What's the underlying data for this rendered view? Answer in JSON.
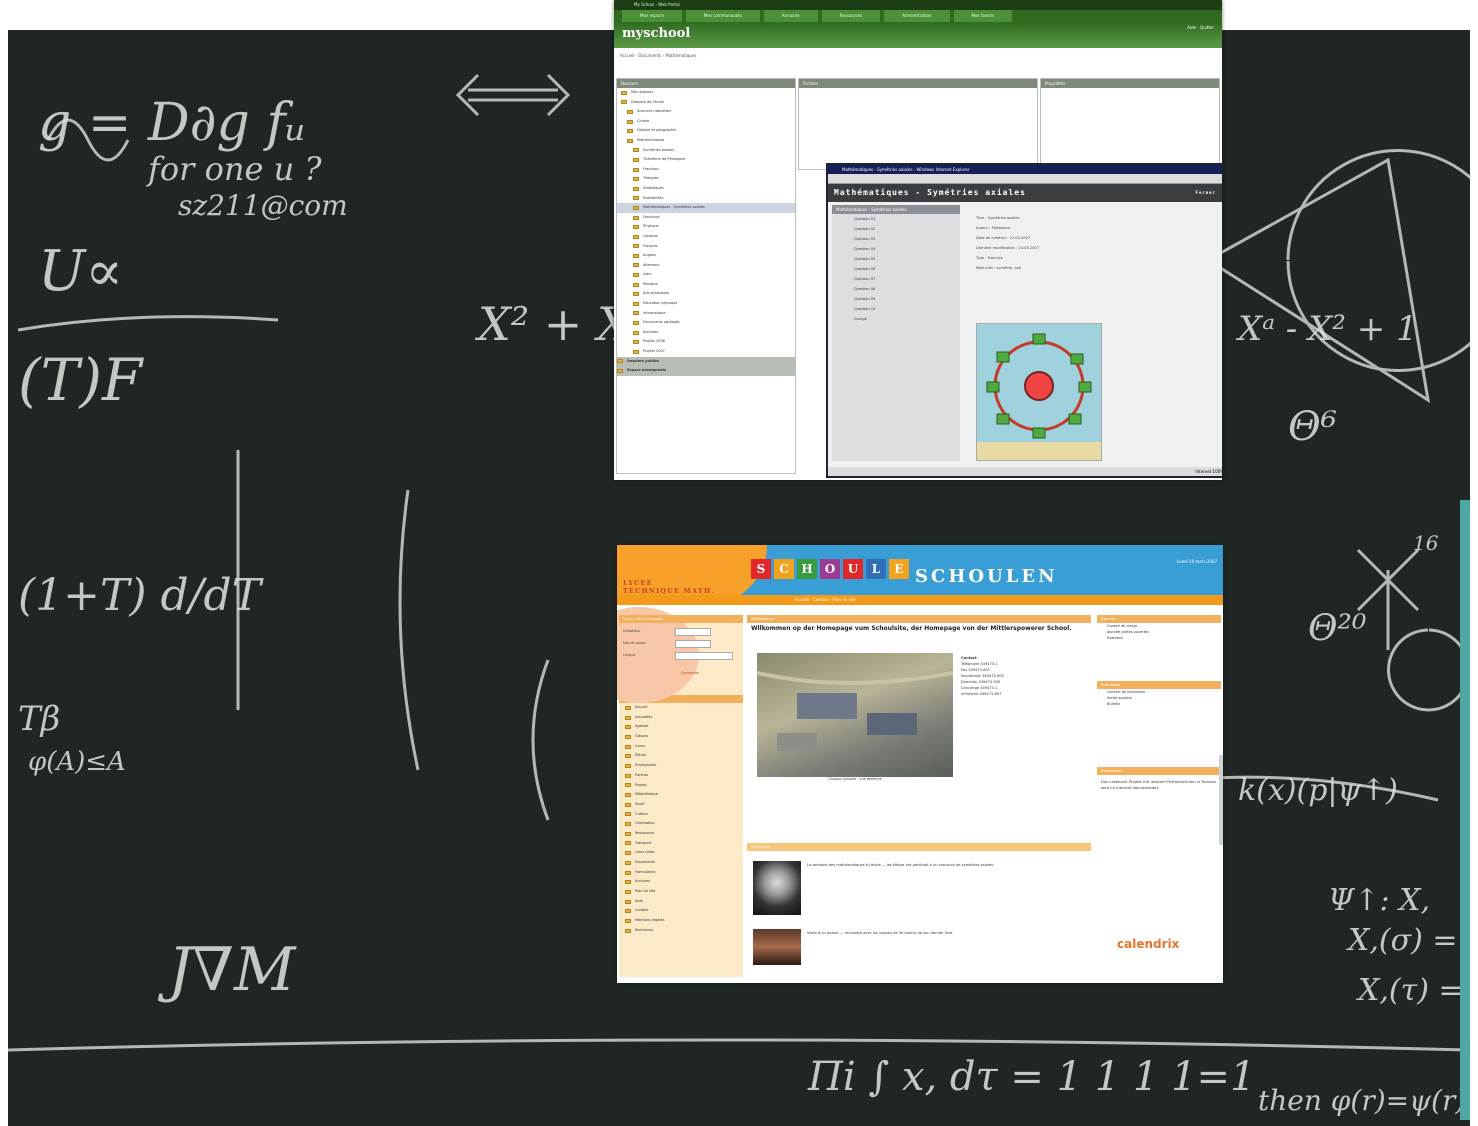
{
  "chalkboard": {
    "accent_color": "#4fa6a2",
    "background_color": "#1f2623",
    "formulas": [
      "g = D∂g fᵤ",
      "for one u ?",
      "sz211@com",
      "U∝",
      "(T)F",
      "(1+T) d/dT",
      "Tβ",
      "φ(A)≤A",
      "J∇M",
      "Πi ∫ x, dτ = 1 1 1 1=1",
      "16",
      "X² + X",
      "Xᵃ - X² + 1",
      "Θ⁶",
      "Θ²⁰",
      "k(x)(p|ψ↑)",
      "Ψ↑: X,",
      "X,(σ) =",
      "X,(τ) =",
      "then φ(r)=ψ(r)"
    ]
  },
  "top_window": {
    "topbar_text": "My School · Web Portal",
    "tabs": [
      "Mon espace",
      "Mes communautés",
      "Annuaire",
      "Ressources",
      "Administration",
      "Mes favoris"
    ],
    "logo": "myschool",
    "user_links": "Aide · Quitter",
    "breadcrumb": "Accueil › Documents › Mathématiques",
    "left_pane_title": "Dossiers",
    "tree_items": [
      "Mes dossiers",
      "Dossiers de l'école",
      "Sciences naturelles",
      "Chimie",
      "Histoire et géographie",
      "Mathématiques",
      "Symétries axiales",
      "Théorème de Pythagore",
      "Fractions",
      "Triangles",
      "Statistiques",
      "Probabilités",
      "Mathématiques - Symétries axiales",
      "Fonctions",
      "Physique",
      "Langues",
      "Français",
      "Anglais",
      "Allemand",
      "Latin",
      "Musique",
      "Arts plastiques",
      "Éducation physique",
      "Informatique",
      "Documents partagés",
      "Archives",
      "Projets 2006",
      "Projets 2007"
    ],
    "tree_groups": [
      "Dossiers publics",
      "Espace enseignants"
    ],
    "middle_pane_title": "Fichiers",
    "right_pane_title": "Propriétés",
    "popup_title": "Mathématiques - Symétries axiales - Windows Internet Explorer",
    "popup_heading": "Mathématiques - Symétries axiales",
    "popup_close": "Fermer",
    "popup_list_header": "Mathématiques - Symétries axiales",
    "popup_items": [
      "Question 01",
      "Question 02",
      "Question 03",
      "Question 04",
      "Question 05",
      "Question 06",
      "Question 07",
      "Question 08",
      "Question 09",
      "Question 10",
      "Corrigé"
    ],
    "popup_fields": [
      "Titre : Symétries axiales",
      "Auteur : Professeur",
      "Date de création : 12.03.2007",
      "Dernière modification : 14.03.2007",
      "Type : Exercice",
      "Mots-clés : symétrie, axe"
    ],
    "popup_footer": "Internet   100%"
  },
  "bottom_window": {
    "banner_letters": [
      "S",
      "C",
      "H",
      "O",
      "U",
      "L",
      "E"
    ],
    "banner_word": "SCHOULEN",
    "school_name_line1": "LYCEE",
    "school_name_line2": "TECHNIQUE MATH.",
    "nav_links": "Accueil · Contact · Plan du site",
    "date": "Lundi 19 mars 2007",
    "login_title": "Login / Mot de passe",
    "login_user": "Utilisateur",
    "login_pass": "Mot de passe",
    "login_lang": "Langue",
    "login_button": "Connexion",
    "nav_title": "Navigation",
    "nav_items": [
      "Accueil",
      "Actualités",
      "Agenda",
      "Classes",
      "Cours",
      "Élèves",
      "Enseignants",
      "Parents",
      "Projets",
      "Médiathèque",
      "Sport",
      "Culture",
      "Orientation",
      "Restaurant",
      "Transport",
      "Liens utiles",
      "Documents",
      "Formulaires",
      "Archives",
      "Plan du site",
      "Aide",
      "Contact",
      "Mentions légales",
      "Recherche"
    ],
    "main_title": "Willkommen",
    "welcome_text": "Wllkommen op der Homepage vum Schoulsite, der Homepage von der Mittlerspowerer School.",
    "photo_caption": "Campus scolaire · vue aérienne",
    "contact_label": "Contact",
    "contact_lines": [
      "Téléphone 349473-1",
      "Fax 349473-801",
      "Secrétariat 349473-900",
      "Direction 349473-300",
      "Concierge 349473-1",
      "Infirmerie 349473-807"
    ],
    "news_header": "Actualités",
    "news": [
      "La semaine des mathématiques à l'école — les élèves ont participé à un concours de symétries axiales.",
      "Visite d'un auteur — rencontre avec les classes de 3e autour de son dernier livre."
    ],
    "right_titles": [
      "Agenda",
      "Rubriques",
      "Partenaires"
    ],
    "right_items": [
      "Conseil de classe",
      "Journée portes ouvertes",
      "Examens",
      "Concert de printemps",
      "Sortie scolaire",
      "Bulletin"
    ],
    "partner_text": "Das Lesebuch-Projekt mit unseren Partnerschulen in Ruanda wird im Internet dokumentiert.",
    "calendar_logo_a": "calend",
    "calendar_logo_b": "rix"
  }
}
